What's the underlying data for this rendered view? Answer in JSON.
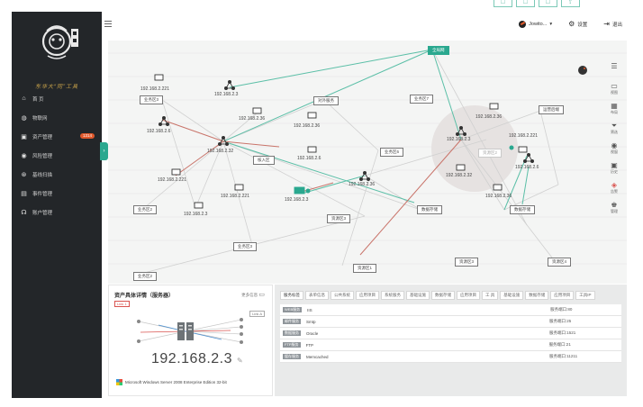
{
  "top_icons": [
    "☐",
    "☐",
    "☐",
    "⇪"
  ],
  "sidebar": {
    "logo_text": "东华大“同”工具",
    "items": [
      {
        "icon": "home-icon",
        "glyph": "⌂",
        "label": "首 页"
      },
      {
        "icon": "globe-icon",
        "glyph": "◍",
        "label": "物联网"
      },
      {
        "icon": "asset-icon",
        "glyph": "▣",
        "label": "资产管理",
        "badge": "1314"
      },
      {
        "icon": "risk-icon",
        "glyph": "◉",
        "label": "风险管理"
      },
      {
        "icon": "scan-icon",
        "glyph": "⊛",
        "label": "基线扫描"
      },
      {
        "icon": "event-icon",
        "glyph": "▤",
        "label": "事件管理"
      },
      {
        "icon": "account-icon",
        "glyph": "☊",
        "label": "账户管理"
      }
    ]
  },
  "header": {
    "user": "Jowito...",
    "settings": "设置",
    "logout": "退出"
  },
  "topology": {
    "nodes": [
      {
        "kind": "label",
        "text": "192.168.2.221"
      },
      {
        "kind": "label",
        "text": "192.168.2.3"
      },
      {
        "kind": "label",
        "text": "192.168.2.36"
      },
      {
        "kind": "label",
        "text": "192.168.2.6"
      },
      {
        "kind": "label",
        "text": "192.168.2.32"
      },
      {
        "kind": "label",
        "text": "192.168.2.36"
      },
      {
        "kind": "label",
        "text": "192.168.2.6"
      },
      {
        "kind": "label",
        "text": "192.168.2.36"
      },
      {
        "kind": "label",
        "text": "192.168.2.221"
      },
      {
        "kind": "label",
        "text": "192.168.2.221"
      },
      {
        "kind": "label",
        "text": "192.168.2.3"
      },
      {
        "kind": "label",
        "text": "192.168.2.3"
      },
      {
        "kind": "label",
        "text": "192.168.2.36"
      },
      {
        "kind": "label",
        "text": "192.168.2.3"
      },
      {
        "kind": "label",
        "text": "192.168.2.32"
      },
      {
        "kind": "label",
        "text": "192.168.2.221"
      },
      {
        "kind": "label",
        "text": "192.168.2.6"
      },
      {
        "kind": "label",
        "text": "192.168.2.36"
      }
    ],
    "boxes": [
      "业务区3",
      "对外服务",
      "业务区7",
      "运营后端",
      "核入区",
      "业务区6",
      "业务区2",
      "数据存储",
      "资源区3",
      "数据存储",
      "业务区3",
      "资源区1",
      "资源区3",
      "资源区4",
      "资源区2",
      "业务区2"
    ],
    "selected_box": "全局网",
    "tools": [
      {
        "icon": "list-icon",
        "glyph": "☰",
        "label": ""
      },
      {
        "icon": "layout-icon",
        "glyph": "▭",
        "label": "视图"
      },
      {
        "icon": "grid-icon",
        "glyph": "▦",
        "label": "布局"
      },
      {
        "icon": "filter-icon",
        "glyph": "⏷",
        "label": "筛选"
      },
      {
        "icon": "eye-icon",
        "glyph": "◉",
        "label": "视窗"
      },
      {
        "icon": "history-icon",
        "glyph": "▣",
        "label": "历史"
      },
      {
        "icon": "alert-icon",
        "glyph": "◈",
        "label": "告警"
      },
      {
        "icon": "admin-icon",
        "glyph": "♚",
        "label": "管理"
      }
    ]
  },
  "detail": {
    "title": "资产具体详情（服务器）",
    "more": "更多信息",
    "tag_red": "Link 1",
    "tag_gray": "Link A",
    "ip": "192.168.2.3",
    "os": "Microsoft Windows Server 2008 Enterprise Edition 32-bit"
  },
  "props": {
    "tabs": [
      "服务标签",
      "表单信息",
      "公共系统",
      "应用项目",
      "系统服务",
      "基础设施",
      "数据存储",
      "应用项目",
      "工 具",
      "基础设施",
      "数据存储",
      "应用项目",
      "工具IP"
    ],
    "rows": [
      {
        "name": "WEB服务",
        "value": "IIS",
        "port": "服务端口:80"
      },
      {
        "name": "邮件服务",
        "value": "Smtp",
        "port": "服务端口:25"
      },
      {
        "name": "数据服务",
        "value": "Oracle",
        "port": "服务端口:1521"
      },
      {
        "name": "FTP服务",
        "value": "FTP",
        "port": "服务端口:21"
      },
      {
        "name": "缓存服务",
        "value": "Memcached",
        "port": "服务端口:11211"
      }
    ]
  }
}
